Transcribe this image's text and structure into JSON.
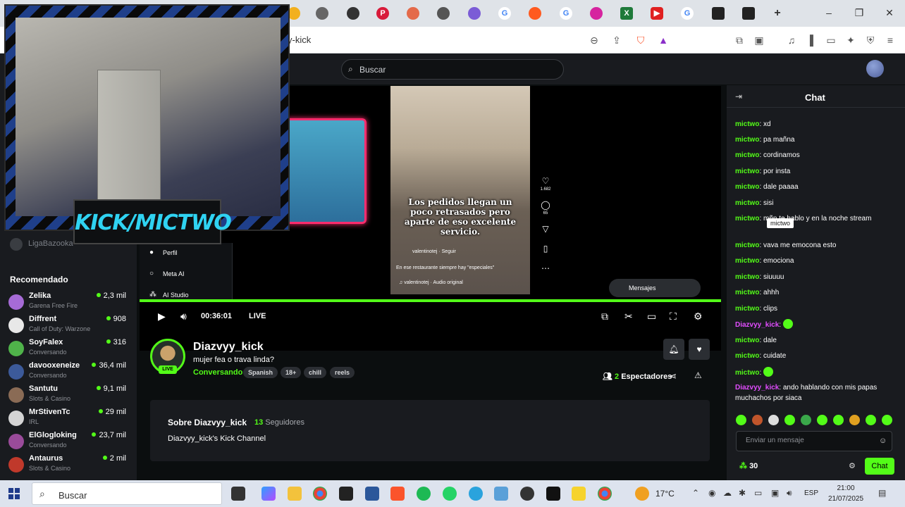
{
  "browser": {
    "url": "y-kick",
    "accent": "#53fc18"
  },
  "topnav": {
    "search_placeholder": "Buscar"
  },
  "sidebar": {
    "liga_label": "LigaBazooka",
    "recommended_title": "Recomendado",
    "channels": [
      {
        "name": "Zelika",
        "game": "Garena Free Fire",
        "viewers": "2,3 mil",
        "color": "#a66bd6"
      },
      {
        "name": "Diffrent",
        "game": "Call of Duty: Warzone",
        "viewers": "908",
        "color": "#e8e8e8"
      },
      {
        "name": "SoyFalex",
        "game": "Conversando",
        "viewers": "316",
        "color": "#4fb34a"
      },
      {
        "name": "davooxeneize",
        "game": "Conversando",
        "viewers": "36,4 mil",
        "color": "#3c5a9a"
      },
      {
        "name": "Santutu",
        "game": "Slots & Casino",
        "viewers": "9,1 mil",
        "color": "#8a6b55"
      },
      {
        "name": "MrStivenTc",
        "game": "IRL",
        "viewers": "29 mil",
        "color": "#d4d4d4"
      },
      {
        "name": "ElGlogloking",
        "game": "Conversando",
        "viewers": "23,7 mil",
        "color": "#9a4b9a"
      },
      {
        "name": "Antaurus",
        "game": "Slots & Casino",
        "viewers": "2 mil",
        "color": "#c0392b"
      }
    ]
  },
  "video": {
    "caption": "Los pedidos llegan un poco retrasados pero aparte de eso excelente servicio.",
    "phone_user": "valentinotej · Seguir",
    "phone_line": "En ese restaurante siempre hay \"especiales\"",
    "phone_audio": "♫ valentinotej · Audio original",
    "like_count": "1.682",
    "comment_count": "65",
    "mensajes_label": "Mensajes",
    "menu": [
      {
        "label": "Perfil"
      },
      {
        "label": "Meta AI"
      },
      {
        "label": "AI Studio"
      }
    ],
    "time": "00:36:01",
    "live_label": "LIVE"
  },
  "stream": {
    "name": "Diazvyy_kick",
    "live_badge": "LIVE",
    "title": "mujer fea o trava linda?",
    "category": "Conversando",
    "tags": [
      "Spanish",
      "18+",
      "chill",
      "reels"
    ],
    "viewers_count": "2",
    "viewers_label": "Espectadores",
    "about_title": "Sobre Diazvyy_kick",
    "followers_count": "13",
    "followers_label": "Seguidores",
    "about_desc": "Diazvyy_kick's Kick Channel"
  },
  "chat": {
    "title": "Chat",
    "messages": [
      {
        "user": "mictwo",
        "text": "xd"
      },
      {
        "user": "mictwo",
        "text": "pa mañna"
      },
      {
        "user": "mictwo",
        "text": "cordinamos"
      },
      {
        "user": "mictwo",
        "text": "por insta"
      },
      {
        "user": "mictwo",
        "text": "dale paaaa"
      },
      {
        "user": "mictwo",
        "text": "sisi"
      },
      {
        "user": "mictwo",
        "text": "mñn te hablo y en la noche stream"
      },
      {
        "user": "mictwo",
        "text": "vava me emocona esto"
      },
      {
        "user": "mictwo",
        "text": "emociona"
      },
      {
        "user": "mictwo",
        "text": "siuuuu"
      },
      {
        "user": "mictwo",
        "text": "ahhh"
      },
      {
        "user": "mictwo",
        "text": "clips"
      },
      {
        "user": "Diazvyy_kick",
        "text": ""
      },
      {
        "user": "mictwo",
        "text": "dale"
      },
      {
        "user": "mictwo",
        "text": "cuidate"
      },
      {
        "user": "mictwo",
        "text": ""
      },
      {
        "user": "Diazvyy_kick",
        "text": "ando hablando con mis papas muchachos por siaca"
      }
    ],
    "tooltip": "mictwo",
    "input_placeholder": "Enviar un mensaje",
    "points": "30",
    "send_label": "Chat"
  },
  "webcam": {
    "tag": "KICK/MICTWO"
  },
  "taskbar": {
    "search_label": "Buscar",
    "weather": "17°C",
    "lang": "ESP",
    "time": "21:00",
    "date": "21/07/2025"
  }
}
